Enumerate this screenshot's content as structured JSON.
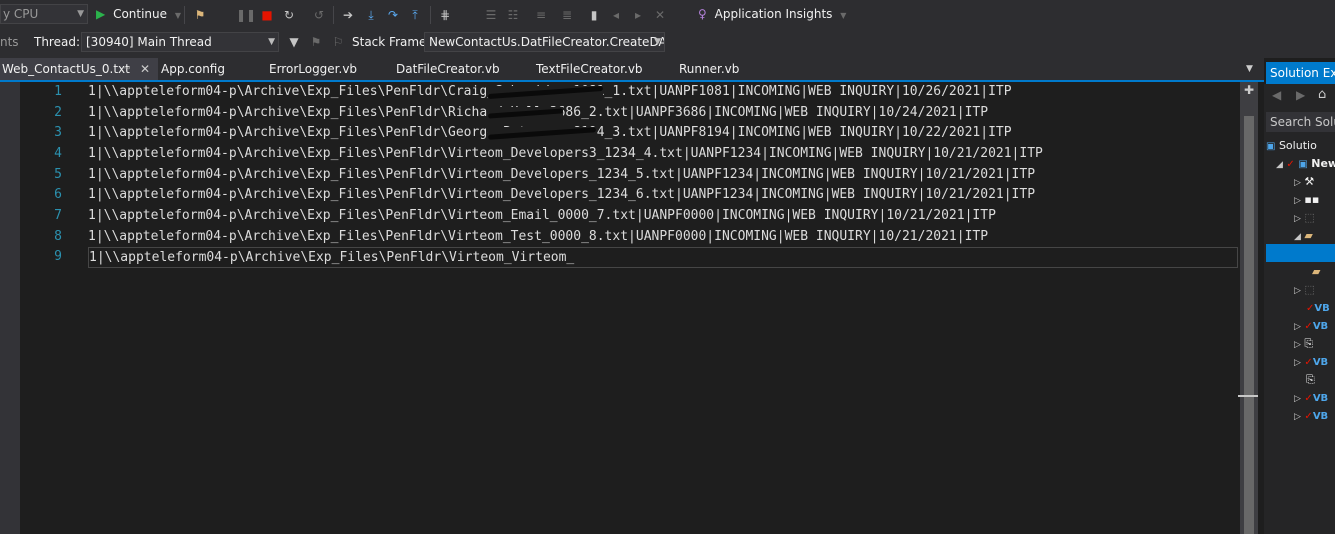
{
  "toolbar": {
    "platform_value": "y CPU",
    "continue_label": "Continue",
    "app_insights_label": "Application Insights"
  },
  "debug_bar": {
    "left_fragment": "nts",
    "thread_label": "Thread:",
    "thread_value": "[30940] Main Thread",
    "stack_frame_label": "Stack Frame:",
    "stack_frame_value": "NewContactUs.DatFileCreator.CreateDATF"
  },
  "tabs": [
    {
      "label": "Web_ContactUs_0.txt",
      "active": true
    },
    {
      "label": "App.config"
    },
    {
      "label": "ErrorLogger.vb"
    },
    {
      "label": "DatFileCreator.vb"
    },
    {
      "label": "TextFileCreator.vb"
    },
    {
      "label": "Runner.vb"
    }
  ],
  "editor": {
    "line_numbers": [
      "1",
      "2",
      "3",
      "4",
      "5",
      "6",
      "7",
      "8",
      "9"
    ],
    "lines": [
      "1|\\\\appteleform04-p\\Archive\\Exp_Files\\PenFldr\\Craig_Schneider_1081_1.txt|UANPF1081|INCOMING|WEB INQUIRY|10/26/2021|ITP",
      "1|\\\\appteleform04-p\\Archive\\Exp_Files\\PenFldr\\Richard_Hall_3686_2.txt|UANPF3686|INCOMING|WEB INQUIRY|10/24/2021|ITP",
      "1|\\\\appteleform04-p\\Archive\\Exp_Files\\PenFldr\\George_Peterson_8194_3.txt|UANPF8194|INCOMING|WEB INQUIRY|10/22/2021|ITP",
      "1|\\\\appteleform04-p\\Archive\\Exp_Files\\PenFldr\\Virteom_Developers3_1234_4.txt|UANPF1234|INCOMING|WEB INQUIRY|10/21/2021|ITP",
      "1|\\\\appteleform04-p\\Archive\\Exp_Files\\PenFldr\\Virteom_Developers_1234_5.txt|UANPF1234|INCOMING|WEB INQUIRY|10/21/2021|ITP",
      "1|\\\\appteleform04-p\\Archive\\Exp_Files\\PenFldr\\Virteom_Developers_1234_6.txt|UANPF1234|INCOMING|WEB INQUIRY|10/21/2021|ITP",
      "1|\\\\appteleform04-p\\Archive\\Exp_Files\\PenFldr\\Virteom_Email_0000_7.txt|UANPF0000|INCOMING|WEB INQUIRY|10/21/2021|ITP",
      "1|\\\\appteleform04-p\\Archive\\Exp_Files\\PenFldr\\Virteom_Test_0000_8.txt|UANPF0000|INCOMING|WEB INQUIRY|10/21/2021|ITP",
      "1|\\\\appteleform04-p\\Archive\\Exp_Files\\PenFldr\\Virteom_Virteom_"
    ]
  },
  "solution_explorer": {
    "title": "Solution Exp",
    "search_placeholder": "Search Solutio",
    "solution_label": "Solutio",
    "project_label": "New",
    "vb_label": "VB"
  },
  "colors": {
    "accent": "#007acc",
    "line_number": "#2b91af",
    "continue_icon": "#2bb24c",
    "stop_icon": "#e51400"
  }
}
